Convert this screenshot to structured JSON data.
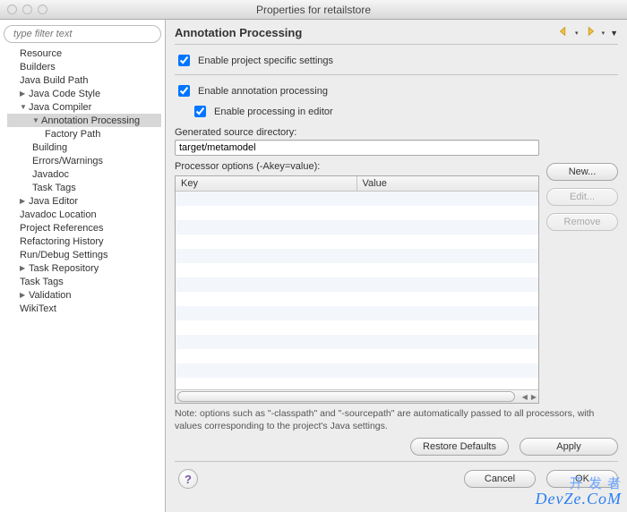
{
  "window": {
    "title": "Properties for retailstore"
  },
  "sidebar": {
    "filter_placeholder": "type filter text",
    "items": [
      {
        "label": "Resource",
        "level": 1
      },
      {
        "label": "Builders",
        "level": 1
      },
      {
        "label": "Java Build Path",
        "level": 1
      },
      {
        "label": "Java Code Style",
        "level": 1,
        "arrow": "right"
      },
      {
        "label": "Java Compiler",
        "level": 1,
        "arrow": "down"
      },
      {
        "label": "Annotation Processing",
        "level": 2,
        "arrow": "down",
        "selected": true
      },
      {
        "label": "Factory Path",
        "level": 3
      },
      {
        "label": "Building",
        "level": 2
      },
      {
        "label": "Errors/Warnings",
        "level": 2
      },
      {
        "label": "Javadoc",
        "level": 2
      },
      {
        "label": "Task Tags",
        "level": 2
      },
      {
        "label": "Java Editor",
        "level": 1,
        "arrow": "right"
      },
      {
        "label": "Javadoc Location",
        "level": 1
      },
      {
        "label": "Project References",
        "level": 1
      },
      {
        "label": "Refactoring History",
        "level": 1
      },
      {
        "label": "Run/Debug Settings",
        "level": 1
      },
      {
        "label": "Task Repository",
        "level": 1,
        "arrow": "right"
      },
      {
        "label": "Task Tags",
        "level": 1
      },
      {
        "label": "Validation",
        "level": 1,
        "arrow": "right"
      },
      {
        "label": "WikiText",
        "level": 1
      }
    ]
  },
  "page": {
    "title": "Annotation Processing",
    "enable_project_specific": {
      "label": "Enable project specific settings",
      "checked": true
    },
    "enable_annotation_processing": {
      "label": "Enable annotation processing",
      "checked": true
    },
    "enable_processing_in_editor": {
      "label": "Enable processing in editor",
      "checked": true
    },
    "generated_source_dir_label": "Generated source directory:",
    "generated_source_dir_value": "target/metamodel",
    "processor_options_label": "Processor options (-Akey=value):",
    "table": {
      "col_key": "Key",
      "col_value": "Value"
    },
    "side_buttons": {
      "new": "New...",
      "edit": "Edit...",
      "remove": "Remove"
    },
    "note": "Note: options such as \"-classpath\" and \"-sourcepath\" are automatically passed to all processors, with values corresponding to the project's Java settings.",
    "bottom": {
      "restore": "Restore Defaults",
      "apply": "Apply"
    }
  },
  "dialog": {
    "cancel": "Cancel",
    "ok": "OK"
  },
  "watermark": {
    "cn": "开 发 者",
    "en": "DevZe.CoM"
  }
}
